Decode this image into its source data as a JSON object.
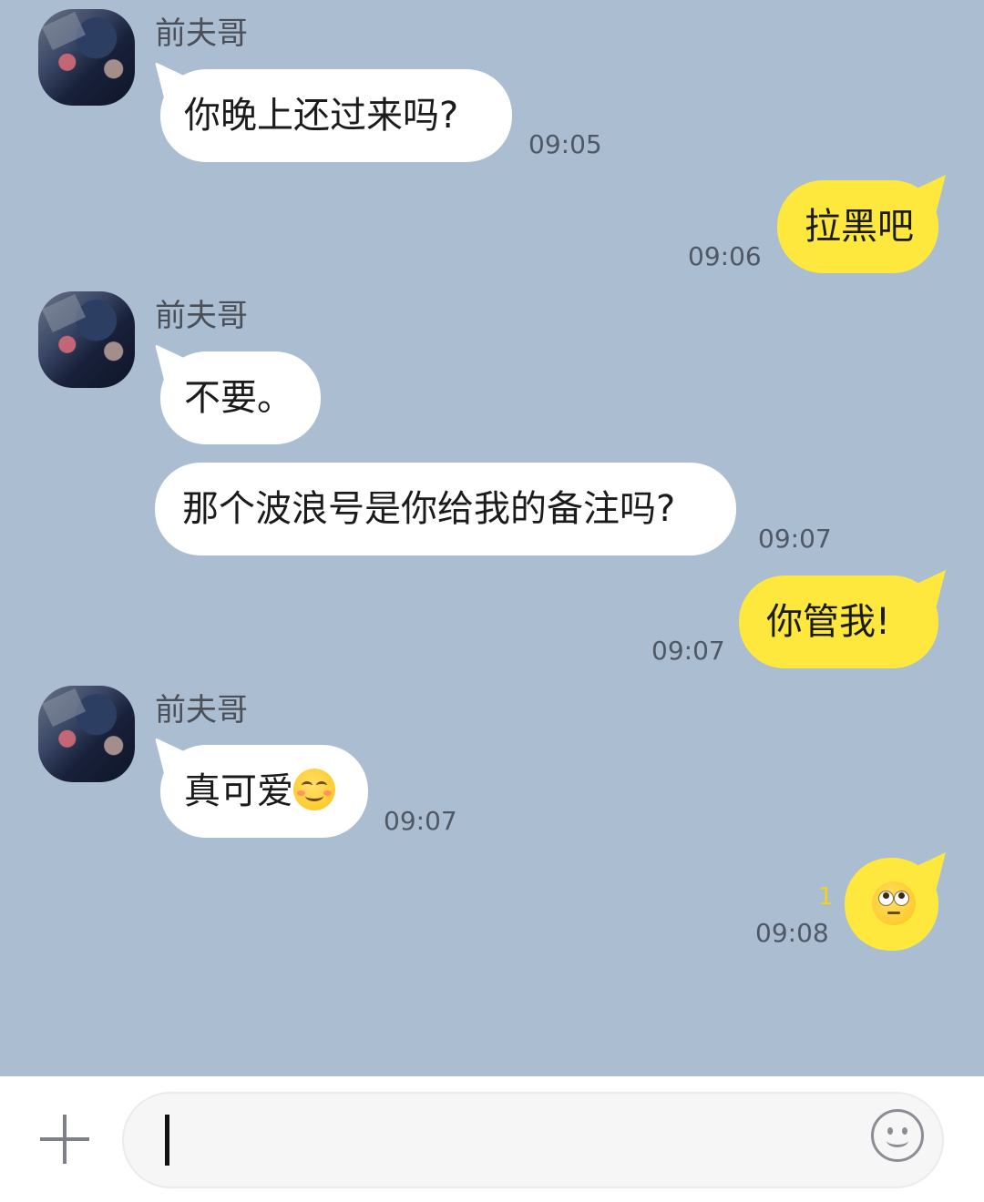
{
  "chat": {
    "contact_name": "前夫哥",
    "messages": [
      {
        "direction": "incoming",
        "text": "你晚上还过来吗?",
        "time": "09:05"
      },
      {
        "direction": "outgoing",
        "text": "拉黑吧",
        "time": "09:06"
      },
      {
        "direction": "incoming",
        "text": "不要。",
        "time": ""
      },
      {
        "direction": "incoming",
        "text": "那个波浪号是你给我的备注吗?",
        "time": "09:07"
      },
      {
        "direction": "outgoing",
        "text": "你管我!",
        "time": "09:07"
      },
      {
        "direction": "incoming",
        "text": "真可爱",
        "emoji": "smiling-face-emoji",
        "time": "09:07"
      },
      {
        "direction": "outgoing",
        "text": "",
        "emoji": "eye-roll-emoji",
        "time": "09:08",
        "unread_count": "1"
      }
    ]
  },
  "input_bar": {
    "value": "",
    "icons": [
      "plus-icon",
      "emoji-icon"
    ]
  },
  "colors": {
    "chat_background": "#aabdd1",
    "incoming_bubble": "#ffffff",
    "outgoing_bubble": "#fee83d",
    "unread_count": "#f1d21c"
  }
}
